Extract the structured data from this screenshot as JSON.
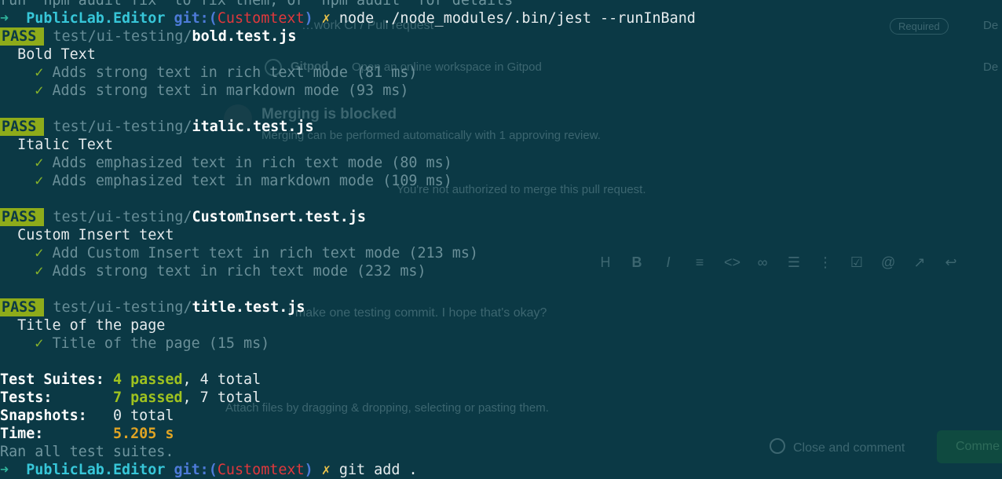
{
  "terminal": {
    "top_line": "run `npm audit fix` to fix them, or `npm audit` for details",
    "prompt": {
      "arrow": "➜",
      "repo": "PublicLab.Editor",
      "git_label": "git:(",
      "branch": "Customtext",
      "git_close": ")",
      "dirty_mark": "✗",
      "command": "node ./node_modules/.bin/jest --runInBand"
    },
    "suites": [
      {
        "badge": "PASS",
        "path": "test/ui-testing/",
        "file": "bold.test.js",
        "name": "Bold Text",
        "tests": [
          "Adds strong text in rich text mode (81 ms)",
          "Adds strong text in markdown mode (93 ms)"
        ]
      },
      {
        "badge": "PASS",
        "path": "test/ui-testing/",
        "file": "italic.test.js",
        "name": "Italic Text",
        "tests": [
          "Adds emphasized text in rich text mode (80 ms)",
          "Adds emphasized text in markdown mode (109 ms)"
        ]
      },
      {
        "badge": "PASS",
        "path": "test/ui-testing/",
        "file": "CustomInsert.test.js",
        "name": "Custom Insert text",
        "tests": [
          "Add Custom Insert text in rich text mode (213 ms)",
          "Adds strong text in rich text mode (232 ms)"
        ]
      },
      {
        "badge": "PASS",
        "path": "test/ui-testing/",
        "file": "title.test.js",
        "name": "Title of the page",
        "tests": [
          "Title of the page (15 ms)"
        ]
      }
    ],
    "check_mark": "✓",
    "summary": {
      "suites_label": "Test Suites:",
      "suites_passed": "4 passed",
      "suites_total": ", 4 total",
      "tests_label": "Tests:",
      "tests_passed": "7 passed",
      "tests_total": ", 7 total",
      "snapshots_label": "Snapshots:",
      "snapshots_value": "0 total",
      "time_label": "Time:",
      "time_value": "5.205 s",
      "ran_all": "Ran all test suites."
    },
    "bottom_prompt": {
      "arrow": "➜",
      "repo": "PublicLab.Editor",
      "git_label": "git:(",
      "branch": "Customtext",
      "git_close": ")",
      "dirty_mark": "✗",
      "command": "git add ."
    }
  },
  "background_page": {
    "pull_request_text": "…work CI / Pull request",
    "required_badge": "Required",
    "details_1": "De",
    "gitpod_label": "Gitpod",
    "gitpod_desc": "Open an online workspace in Gitpod",
    "details_2": "De",
    "merge_title": "Merging is blocked",
    "merge_desc": "Merging can be performed automatically with 1 approving review.",
    "merge_note": "You're not authorized to merge this pull request.",
    "comment_text": "I make one testing commit. I hope that's okay?",
    "attach_text": "Attach files by dragging & dropping, selecting or pasting them.",
    "close_comment_label": "Close and comment",
    "comment_button": "Comme",
    "toolbar_icons": [
      "H",
      "B",
      "I",
      "≡",
      "<>",
      "🔗",
      "☰",
      "1≡",
      "☑",
      "@",
      "↗",
      "↩"
    ]
  },
  "colors": {
    "background": "#0b3945",
    "pass_badge": "#8eab1a",
    "branch": "#e0383c",
    "repo": "#37c6d8"
  }
}
